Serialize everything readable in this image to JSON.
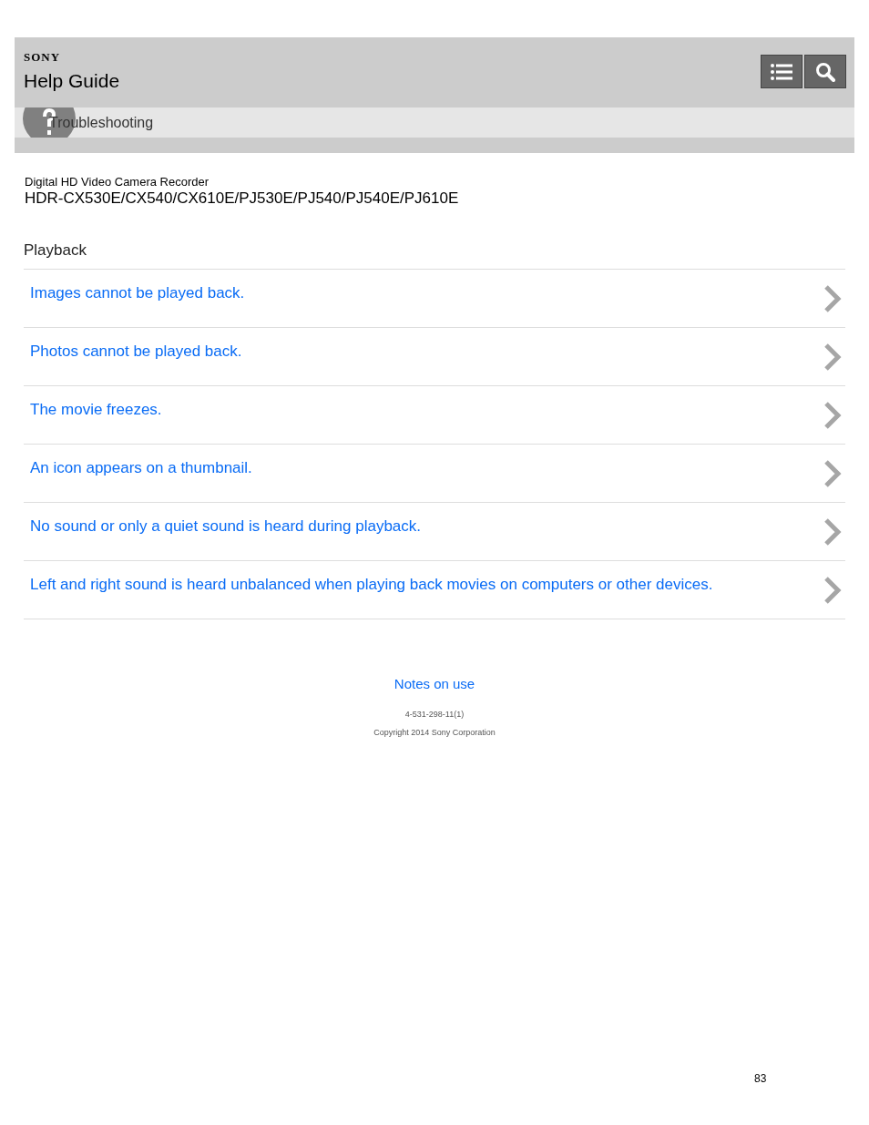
{
  "header": {
    "brand": "SONY",
    "title": "Help Guide"
  },
  "breadcrumb": "Troubleshooting",
  "product": {
    "name": "Digital HD Video Camera Recorder",
    "models": "HDR-CX530E/CX540/CX610E/PJ530E/PJ540/PJ540E/PJ610E"
  },
  "section": {
    "title": "Playback",
    "links": [
      "Images cannot be played back.",
      "Photos cannot be played back.",
      "The movie freezes.",
      "An icon appears on a thumbnail.",
      "No sound or only a quiet sound is heard during playback.",
      "Left and right sound is heard unbalanced when playing back movies on computers or other devices."
    ]
  },
  "footer": {
    "link": "Notes on use",
    "code": "4-531-298-11(1)",
    "copyright": "Copyright 2014 Sony Corporation"
  },
  "page_number": "83"
}
